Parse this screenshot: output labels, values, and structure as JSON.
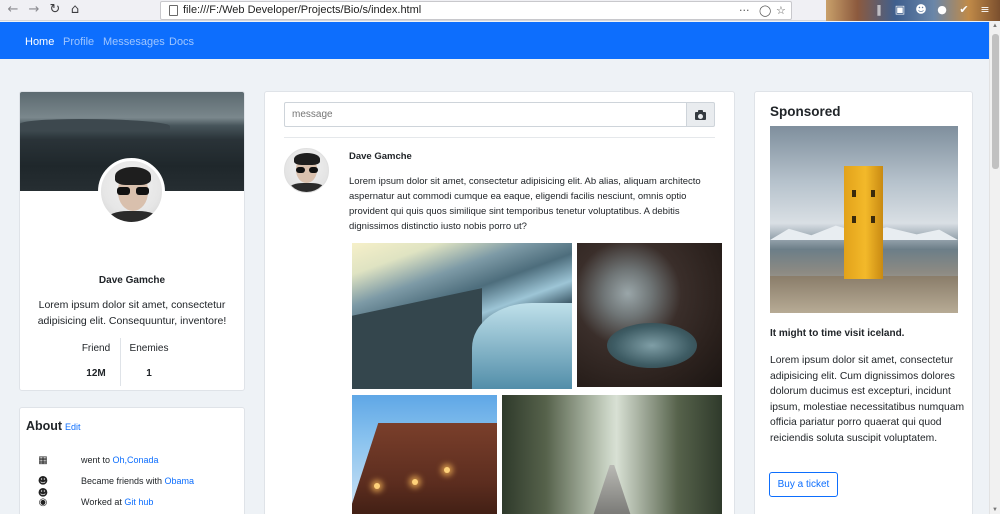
{
  "browser": {
    "url": "file:///F:/Web Developer/Projects/Bio/s/index.html",
    "menu_dots": "···"
  },
  "navbar": {
    "items": [
      {
        "label": "Home",
        "active": true
      },
      {
        "label": "Profile",
        "active": false
      },
      {
        "label": "Messesages",
        "active": false
      },
      {
        "label": "Docs",
        "active": false
      }
    ]
  },
  "profile": {
    "name": "Dave Gamche",
    "bio": "Lorem ipsum dolor sit amet, consectetur adipisicing elit. Consequuntur, inventore!",
    "stats": [
      {
        "label": "Friend",
        "value": "12M"
      },
      {
        "label": "Enemies",
        "value": "1"
      }
    ]
  },
  "about": {
    "title": "About",
    "edit_label": "Edit",
    "items": [
      {
        "icon": "calendar-icon",
        "text": "went to ",
        "link": "Oh,Conada"
      },
      {
        "icon": "users-icon",
        "text": "Became friends with ",
        "link": "Obama"
      },
      {
        "icon": "github-icon",
        "text": "Worked at ",
        "link": "Git hub"
      }
    ]
  },
  "composer": {
    "placeholder": "message",
    "camera_icon": "camera-icon"
  },
  "post": {
    "author": "Dave Gamche",
    "text": "Lorem ipsum dolor sit amet, consectetur adipisicing elit. Ab alias, aliquam architecto aspernatur aut commodi cumque ea eaque, eligendi facilis nesciunt, omnis optio provident qui quis quos similique sint temporibus tenetur voluptatibus. A debitis dignissimos distinctio iusto nobis porro ut?"
  },
  "sponsored": {
    "title": "Sponsored",
    "headline": "It might to time visit iceland.",
    "text": "Lorem ipsum dolor sit amet, consectetur adipisicing elit. Cum dignissimos dolores dolorum ducimus est excepturi, incidunt ipsum, molestiae necessitatibus numquam officia pariatur porro quaerat qui quod reiciendis soluta suscipit voluptatem.",
    "button_label": "Buy a ticket"
  },
  "colors": {
    "navbar": "#0d6efd",
    "link": "#0d6efd",
    "page_background": "#eef2f6"
  }
}
